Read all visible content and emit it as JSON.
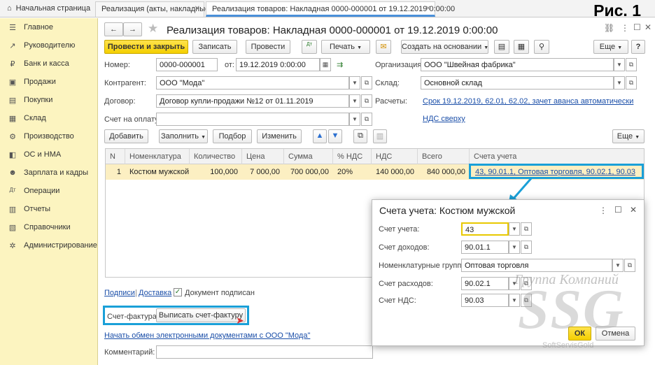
{
  "tabs": {
    "home": "Начальная страница",
    "tab1": "Реализация (акты, накладные)",
    "tab2": "Реализация товаров: Накладная 0000-000001 от 19.12.2019 0:00:00"
  },
  "figure_label": "Рис. 1",
  "sidebar": {
    "items": [
      {
        "label": "Главное",
        "icon": "menu-icon"
      },
      {
        "label": "Руководителю",
        "icon": "chart-icon"
      },
      {
        "label": "Банк и касса",
        "icon": "bank-icon"
      },
      {
        "label": "Продажи",
        "icon": "sales-icon"
      },
      {
        "label": "Покупки",
        "icon": "cart-icon"
      },
      {
        "label": "Склад",
        "icon": "warehouse-icon"
      },
      {
        "label": "Производство",
        "icon": "factory-icon"
      },
      {
        "label": "ОС и НМА",
        "icon": "assets-icon"
      },
      {
        "label": "Зарплата и кадры",
        "icon": "people-icon"
      },
      {
        "label": "Операции",
        "icon": "operations-icon"
      },
      {
        "label": "Отчеты",
        "icon": "reports-icon"
      },
      {
        "label": "Справочники",
        "icon": "books-icon"
      },
      {
        "label": "Администрирование",
        "icon": "gear-icon"
      }
    ]
  },
  "doc": {
    "title": "Реализация товаров: Накладная 0000-000001 от 19.12.2019 0:00:00"
  },
  "toolbar": {
    "post_close": "Провести и закрыть",
    "save": "Записать",
    "post": "Провести",
    "print": "Печать",
    "create_based": "Создать на основании",
    "more": "Еще",
    "help": "?"
  },
  "form": {
    "number_label": "Номер:",
    "number": "0000-000001",
    "date_label": "от:",
    "date": "19.12.2019  0:00:00",
    "org_label": "Организация:",
    "org": "ООО \"Швейная фабрика\"",
    "contractor_label": "Контрагент:",
    "contractor": "ООО \"Мода\"",
    "warehouse_label": "Склад:",
    "warehouse": "Основной склад",
    "contract_label": "Договор:",
    "contract": "Договор купли-продажи №12 от 01.11.2019",
    "settlements_label": "Расчеты:",
    "settlements_link": "Срок 19.12.2019, 62.01, 62.02, зачет аванса автоматически",
    "invoice_label": "Счет на оплату:",
    "vat_link": "НДС сверху"
  },
  "table_toolbar": {
    "add": "Добавить",
    "fill": "Заполнить",
    "pick": "Подбор",
    "change": "Изменить",
    "more": "Еще"
  },
  "table": {
    "headers": [
      "N",
      "Номенклатура",
      "Количество",
      "Цена",
      "Сумма",
      "% НДС",
      "НДС",
      "Всего",
      "Счета учета"
    ],
    "rows": [
      [
        "1",
        "Костюм мужской",
        "100,000",
        "7 000,00",
        "700 000,00",
        "20%",
        "140 000,00",
        "840 000,00",
        "43, 90.01.1, Оптовая торговля, 90.02.1, 90.03"
      ]
    ]
  },
  "footer": {
    "signatures": "Подписи",
    "delivery": "Доставка",
    "signed": "Документ подписан",
    "invoice_label": "Счет-фактура:",
    "invoice_btn": "Выписать счет-фактуру",
    "edo_link": "Начать обмен электронными документами с ООО \"Мода\"",
    "comment_label": "Комментарий:"
  },
  "dialog": {
    "title": "Счета учета: Костюм мужской",
    "account_label": "Счет учета:",
    "account": "43",
    "income_label": "Счет доходов:",
    "income": "90.01.1",
    "groups_label": "Номенклатурные группы:",
    "groups": "Оптовая торговля",
    "expense_label": "Счет расходов:",
    "expense": "90.02.1",
    "vat_label": "Счет НДС:",
    "vat": "90.03",
    "ok": "ОК",
    "cancel": "Отмена"
  },
  "watermark": {
    "line1": "Группа Компаний",
    "line2": "SSG",
    "line3": "SoftServisGold"
  },
  "colors": {
    "accent_yellow": "#f4cf00",
    "highlight_blue": "#1aa0d8",
    "sidebar_bg": "#fcf4c0",
    "selected_row": "#fcefc2",
    "link": "#1a4ea8"
  }
}
